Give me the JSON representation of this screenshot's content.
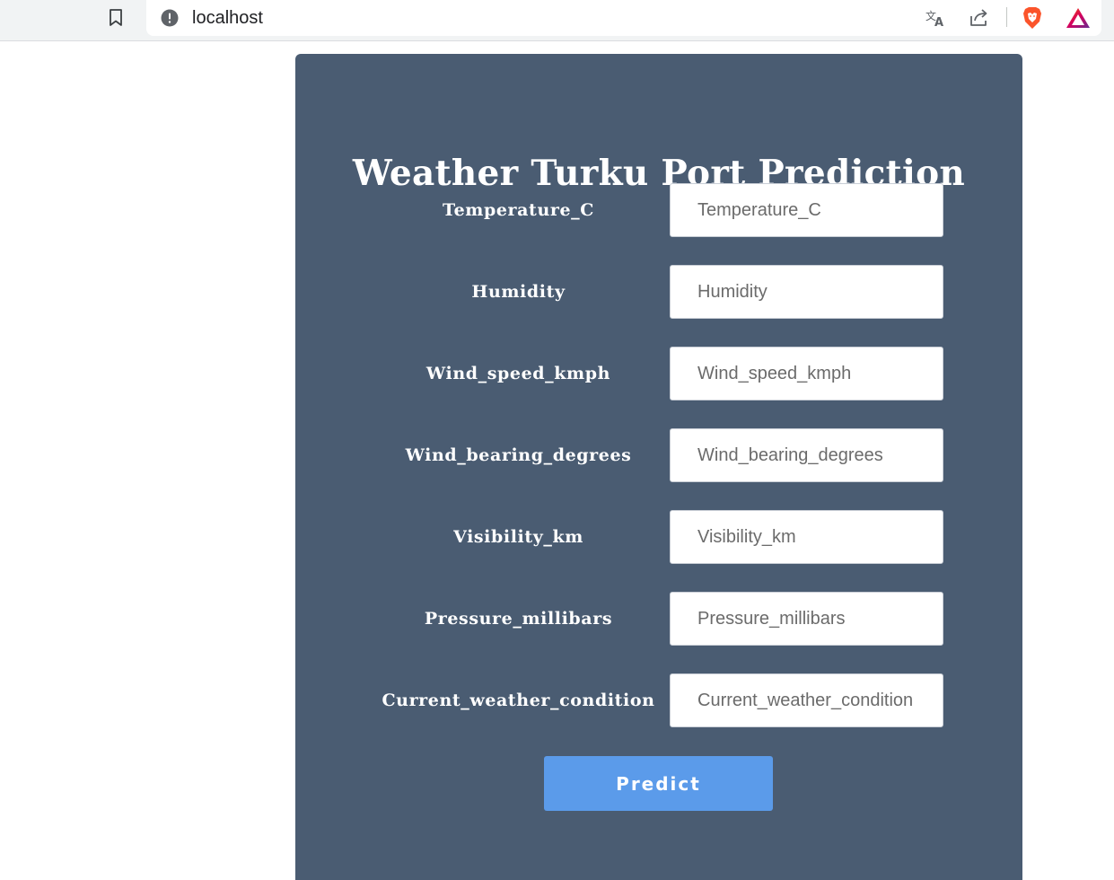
{
  "browser": {
    "url": "localhost",
    "icons": {
      "bookmark": "bookmark-icon",
      "site_info": "info-icon",
      "translate": "translate-icon",
      "share": "share-icon",
      "brave_shields": "brave-lion-icon",
      "brave_rewards": "brave-rewards-triangle-icon"
    },
    "colors": {
      "brave_orange": "#fb542b",
      "rewards_purple": "#662d91"
    }
  },
  "page": {
    "title": "Weather Turku Port Prediction",
    "background": "#4a5c72",
    "fields": [
      {
        "label": "Temperature_C",
        "placeholder": "Temperature_C",
        "value": ""
      },
      {
        "label": "Humidity",
        "placeholder": "Humidity",
        "value": ""
      },
      {
        "label": "Wind_speed_kmph",
        "placeholder": "Wind_speed_kmph",
        "value": ""
      },
      {
        "label": "Wind_bearing_degrees",
        "placeholder": "Wind_bearing_degrees",
        "value": ""
      },
      {
        "label": "Visibility_km",
        "placeholder": "Visibility_km",
        "value": ""
      },
      {
        "label": "Pressure_millibars",
        "placeholder": "Pressure_millibars",
        "value": ""
      },
      {
        "label": "Current_weather_condition",
        "placeholder": "Current_weather_condition",
        "value": ""
      }
    ],
    "submit_label": "Predict",
    "submit_color": "#5b9bea"
  }
}
